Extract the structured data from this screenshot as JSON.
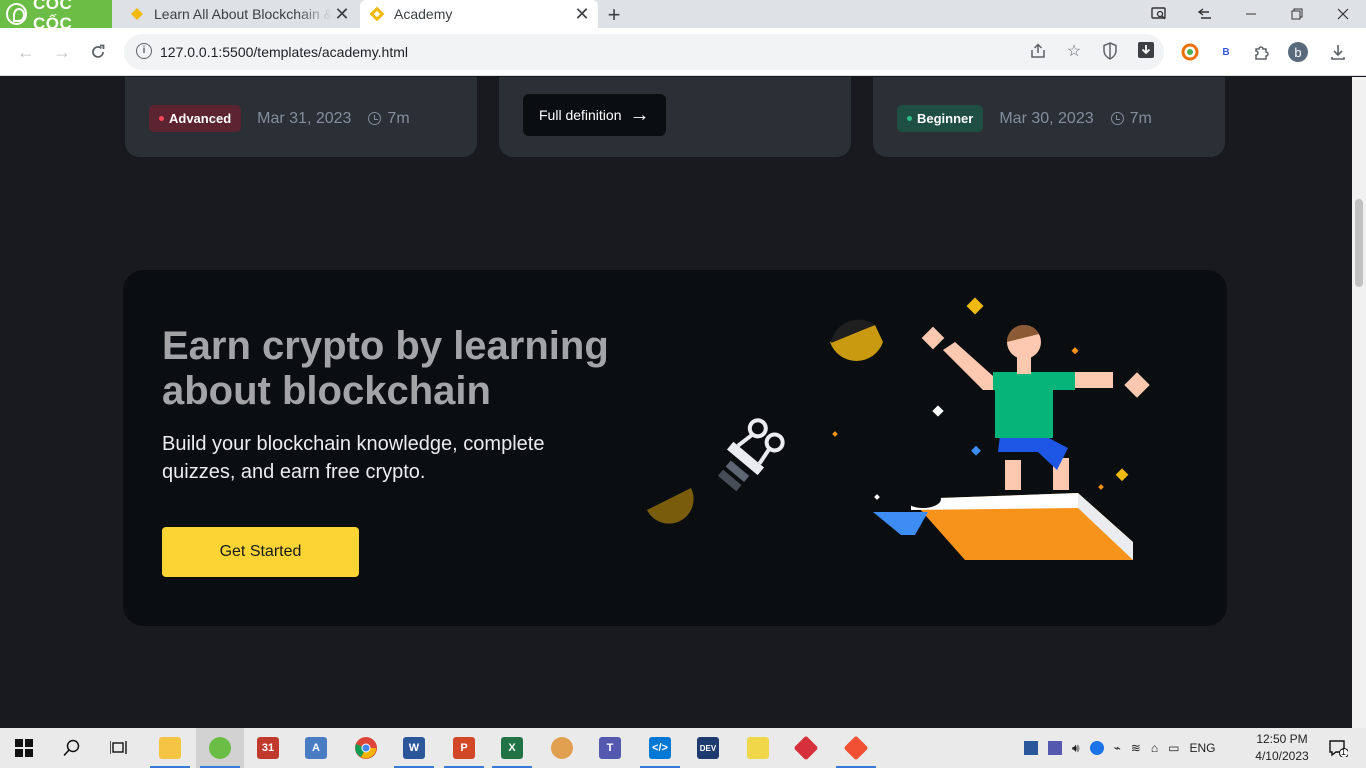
{
  "browser": {
    "brand": "CỐC CỐC",
    "tabs": [
      {
        "title": "Learn All About Blockchain & Crypto",
        "active": false
      },
      {
        "title": "Academy",
        "active": true
      }
    ],
    "url": "127.0.0.1:5500/templates/academy.html",
    "profile_initial": "b",
    "ext_b": "B"
  },
  "cards": [
    {
      "badge": "Advanced",
      "level": "advanced",
      "date": "Mar 31, 2023",
      "read_time": "7m"
    },
    {
      "button": "Full definition"
    },
    {
      "badge": "Beginner",
      "level": "beginner",
      "date": "Mar 30, 2023",
      "read_time": "7m"
    }
  ],
  "promo": {
    "title": "Earn crypto by learning about blockchain",
    "subtitle": "Build your blockchain knowledge, complete quizzes, and earn free crypto.",
    "cta": "Get Started"
  },
  "taskbar": {
    "apps": [
      "start",
      "search",
      "task-view",
      "file-explorer",
      "coccoc",
      "calendar-app",
      "notepad-app",
      "chrome",
      "word",
      "powerpoint",
      "excel",
      "paint",
      "teams",
      "vscode",
      "devc",
      "sharex",
      "git-app",
      "sourcetree"
    ],
    "language": "ENG",
    "time": "12:50 PM",
    "date": "4/10/2023",
    "notifications": "1"
  },
  "colors": {
    "page_bg": "#181a20",
    "card_bg": "#2b2f36",
    "promo_bg": "#0b0e11",
    "accent_yellow": "#fcd535",
    "advanced_red": "#f6465d",
    "beginner_green": "#2ebd85"
  }
}
